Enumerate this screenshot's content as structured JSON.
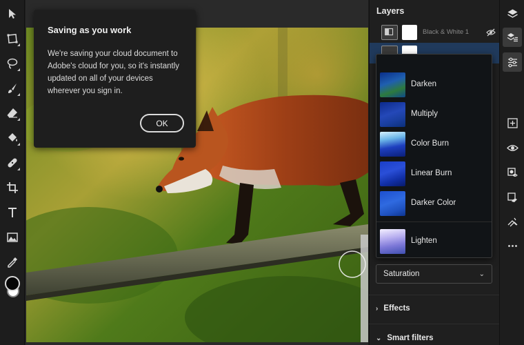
{
  "dialog": {
    "title": "Saving as you work",
    "body": "We're saving your cloud document to Adobe's cloud for you, so it's instantly updated on all of your devices wherever you sign in.",
    "ok_label": "OK"
  },
  "layers_panel": {
    "title": "Layers",
    "layers": [
      {
        "name": "Black & White 1",
        "visible": false
      }
    ]
  },
  "blend_modes": {
    "options": [
      "Darken",
      "Multiply",
      "Color Burn",
      "Linear Burn",
      "Darker Color",
      "Lighten"
    ]
  },
  "mode_select": {
    "value": "Saturation"
  },
  "sections": {
    "effects": "Effects",
    "smart_filters": "Smart filters"
  },
  "left_tools": [
    "select-icon",
    "transform-icon",
    "lasso-icon",
    "brush-icon",
    "eraser-icon",
    "paint-bucket-icon",
    "healing-icon",
    "crop-icon",
    "type-icon",
    "image-icon",
    "eyedropper-icon"
  ],
  "right_tools": [
    "layers-icon",
    "layer-properties-icon",
    "adjustments-icon",
    "add-layer-icon",
    "visibility-icon",
    "mask-icon",
    "clipping-icon",
    "fx-icon",
    "more-icon"
  ],
  "colors": {
    "foreground": "#050505",
    "background": "#ffffff",
    "selection": "#203a5c",
    "panel": "#1f1f1f"
  }
}
